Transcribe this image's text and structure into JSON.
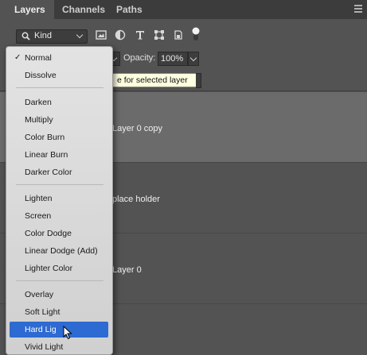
{
  "tabs": [
    {
      "label": "Layers",
      "active": true
    },
    {
      "label": "Channels",
      "active": false
    },
    {
      "label": "Paths",
      "active": false
    }
  ],
  "filter": {
    "kind_label": "Kind",
    "icons": [
      "search-icon",
      "image-filter-icon",
      "adjustment-filter-icon",
      "type-filter-icon",
      "shape-filter-icon",
      "smart-object-filter-icon",
      "filter-toggle-icon"
    ]
  },
  "blend": {
    "opacity_label": "Opacity:",
    "opacity_value": "100%"
  },
  "tooltip": {
    "text": "e for selected layer"
  },
  "layers": [
    {
      "name": "Layer 0 copy",
      "selected": true
    },
    {
      "name": "place holder",
      "selected": false
    },
    {
      "name": "Layer 0",
      "selected": false
    }
  ],
  "blend_menu": {
    "checked_item": "Normal",
    "highlighted_item": "Hard Light",
    "groups": [
      [
        "Normal",
        "Dissolve"
      ],
      [
        "Darken",
        "Multiply",
        "Color Burn",
        "Linear Burn",
        "Darker Color"
      ],
      [
        "Lighten",
        "Screen",
        "Color Dodge",
        "Linear Dodge (Add)",
        "Lighter Color"
      ],
      [
        "Overlay",
        "Soft Light",
        "Hard Light",
        "Vivid Light"
      ]
    ],
    "highlighted_label": "Hard Lig"
  },
  "colors": {
    "panel_bg": "#535353",
    "tab_bar": "#3c3c3c",
    "selected_layer": "#6b6b6b",
    "menu_highlight": "#2d6ad1",
    "tooltip_bg": "#ffffe1"
  }
}
